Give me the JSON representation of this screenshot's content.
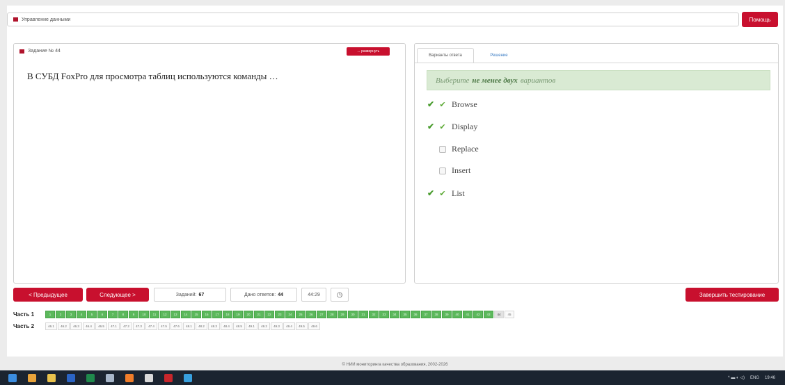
{
  "header": {
    "section": "Управление данными",
    "help_label": "Помощь"
  },
  "task": {
    "title": "Задание № 44",
    "expand_label": "↔ развернуть",
    "question": "В СУБД FoxPro для просмотра таблиц используются команды …"
  },
  "answers": {
    "tabs": [
      "Варианты ответа",
      "Решение"
    ],
    "hint_prefix": "Выберите",
    "hint_bold": "не менее двух",
    "hint_suffix": "вариантов",
    "options": [
      {
        "label": "Browse",
        "checked": true,
        "correct": true
      },
      {
        "label": "Display",
        "checked": true,
        "correct": true
      },
      {
        "label": "Replace",
        "checked": false,
        "correct": false
      },
      {
        "label": "Insert",
        "checked": false,
        "correct": false
      },
      {
        "label": "List",
        "checked": true,
        "correct": true
      }
    ]
  },
  "nav": {
    "prev_label": "< Предыдущее",
    "next_label": "Следующее >",
    "tasks_label": "Заданий:",
    "tasks_value": "67",
    "answered_label": "Дано ответов:",
    "answered_value": "44",
    "timer": "44:29",
    "finish_label": "Завершить тестирование"
  },
  "progress": {
    "part1_label": "Часть 1",
    "part2_label": "Часть 2",
    "part1": [
      "1",
      "2",
      "3",
      "4",
      "5",
      "6",
      "7",
      "8",
      "9",
      "10",
      "11",
      "12",
      "13",
      "14",
      "15",
      "16",
      "17",
      "18",
      "19",
      "20",
      "21",
      "22",
      "23",
      "24",
      "25",
      "26",
      "27",
      "28",
      "29",
      "30",
      "31",
      "32",
      "33",
      "34",
      "35",
      "36",
      "37",
      "38",
      "39",
      "40",
      "41",
      "42",
      "43",
      "44",
      "45"
    ],
    "part1_done_count": 43,
    "part1_current": "44",
    "part2": [
      "46.1",
      "46.2",
      "46.3",
      "46.4",
      "46.5",
      "47.1",
      "47.2",
      "47.3",
      "47.4",
      "47.5",
      "47.6",
      "48.1",
      "48.2",
      "48.3",
      "48.4",
      "48.5",
      "49.1",
      "49.2",
      "49.3",
      "49.4",
      "49.5",
      "49.6"
    ]
  },
  "footer": {
    "copyright": "© НИИ мониторинга качества образования, 2002-2026"
  },
  "taskbar": {
    "tray_lang": "ENG",
    "tray_time": "19:46",
    "icons": [
      {
        "name": "windows-start-icon",
        "color": "#3b8de0"
      },
      {
        "name": "chrome-icon",
        "color": "#e8a33a"
      },
      {
        "name": "file-explorer-icon",
        "color": "#e9c24c"
      },
      {
        "name": "word-icon",
        "color": "#2b64c4"
      },
      {
        "name": "excel-icon",
        "color": "#1f8a4c"
      },
      {
        "name": "app-icon",
        "color": "#a7b6c9"
      },
      {
        "name": "firefox-icon",
        "color": "#f07d2a"
      },
      {
        "name": "yandex-browser-icon",
        "color": "#d9d9d9"
      },
      {
        "name": "filezilla-icon",
        "color": "#c8262b"
      },
      {
        "name": "telegram-icon",
        "color": "#38a0de"
      }
    ]
  }
}
